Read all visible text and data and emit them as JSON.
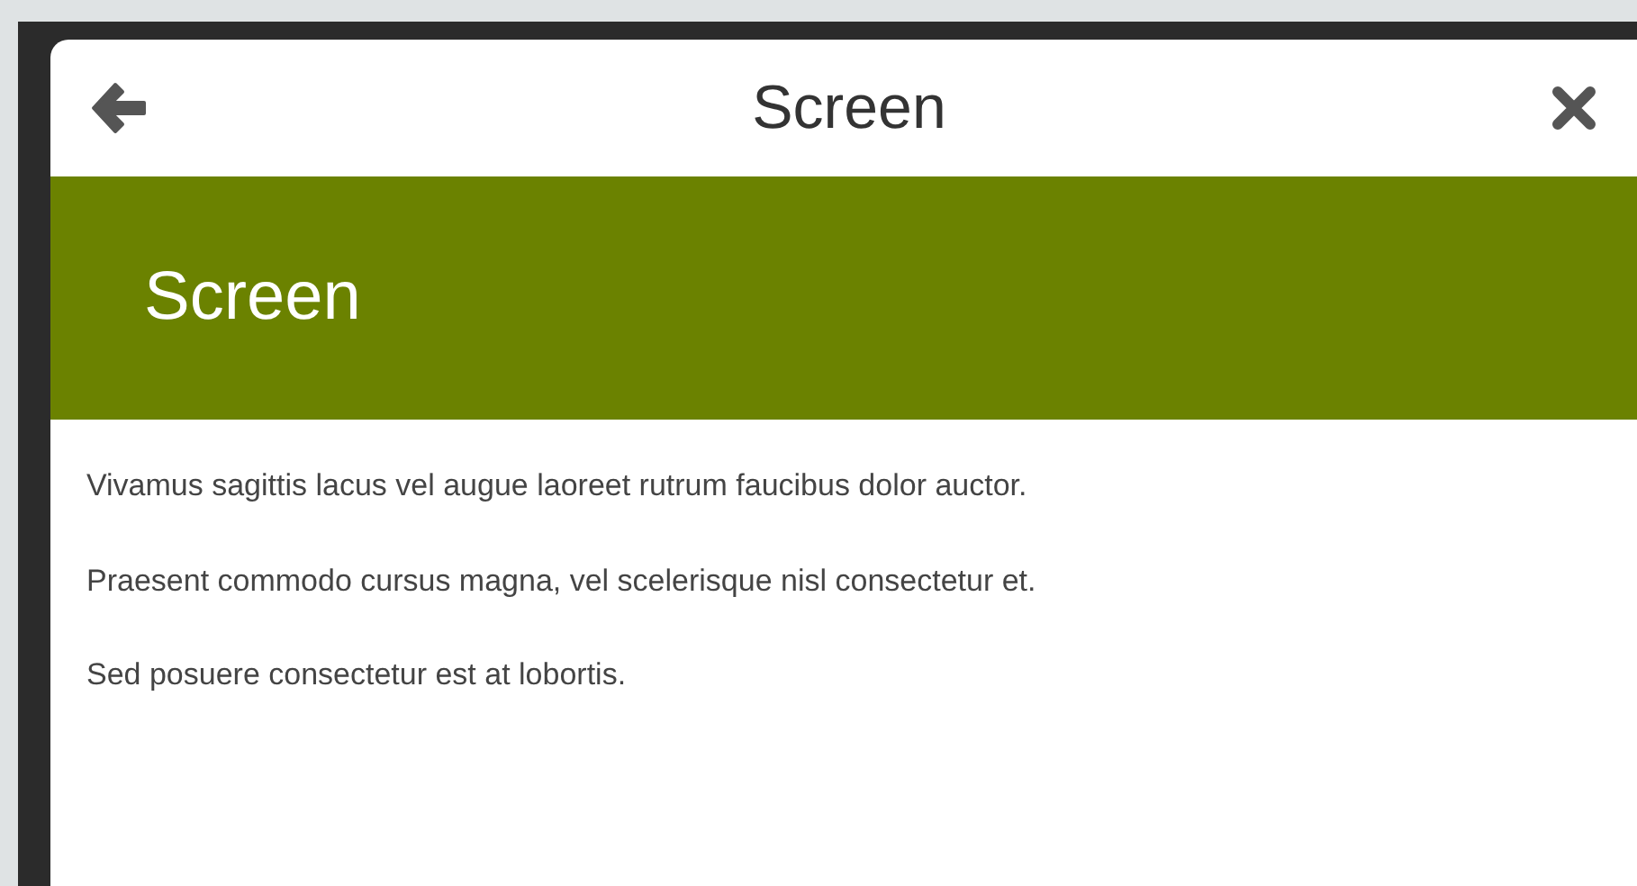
{
  "header": {
    "title": "Screen"
  },
  "banner": {
    "title": "Screen"
  },
  "paragraphs": [
    "Vivamus sagittis lacus vel augue laoreet rutrum faucibus dolor auctor.",
    "Praesent commodo cursus magna, vel scelerisque nisl consectetur et.",
    "Sed posuere consectetur est at lobortis."
  ]
}
